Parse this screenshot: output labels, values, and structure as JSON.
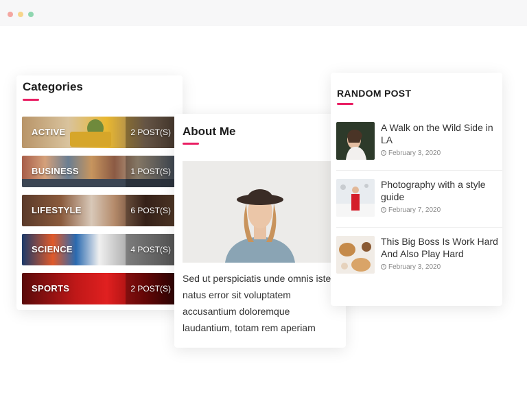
{
  "categories": {
    "title": "Categories",
    "items": [
      {
        "name": "ACTIVE",
        "count": "2 POST(S)"
      },
      {
        "name": "BUSINESS",
        "count": "1 POST(S)"
      },
      {
        "name": "LIFESTYLE",
        "count": "6 POST(S)"
      },
      {
        "name": "SCIENCE",
        "count": "4 POST(S)"
      },
      {
        "name": "SPORTS",
        "count": "2 POST(S)"
      }
    ]
  },
  "about": {
    "title": "About Me",
    "text": "Sed ut perspiciatis unde omnis iste natus error sit voluptatem accusantium doloremque laudantium, totam rem aperiam"
  },
  "random_post": {
    "title": "RANDOM POST",
    "posts": [
      {
        "title": "A Walk on the Wild Side in LA",
        "date": "February 3, 2020"
      },
      {
        "title": "Photography with a style guide",
        "date": "February 7, 2020"
      },
      {
        "title": "This Big Boss Is Work Hard And Also Play Hard",
        "date": "February 3, 2020"
      }
    ]
  },
  "colors": {
    "accent": "#e91e63"
  }
}
